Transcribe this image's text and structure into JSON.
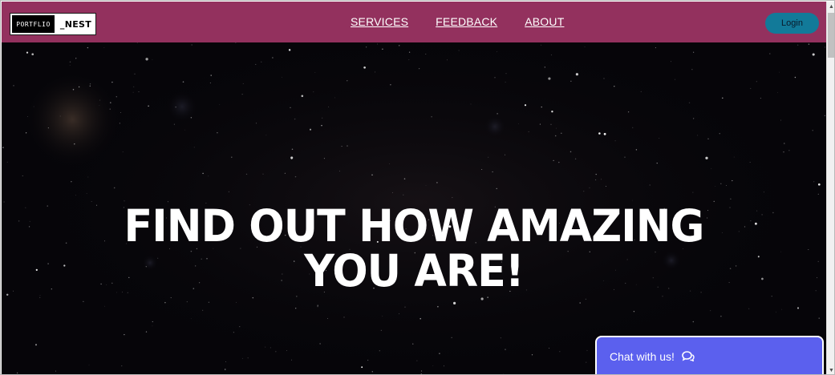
{
  "header": {
    "logo": {
      "left_text": "PORTFLIO",
      "right_text": "_NEST"
    },
    "nav": [
      {
        "label": "SERVICES"
      },
      {
        "label": "FEEDBACK"
      },
      {
        "label": "ABOUT"
      }
    ],
    "login_label": "Login",
    "colors": {
      "navbar": "#93315e",
      "login": "#127a99"
    }
  },
  "hero": {
    "title_line1": "FIND OUT HOW AMAZING",
    "title_line2": "YOU ARE!",
    "background": "#060509"
  },
  "chat": {
    "label": "Chat with us!",
    "icon": "chat-bubbles-icon",
    "color": "#5b60ee"
  }
}
